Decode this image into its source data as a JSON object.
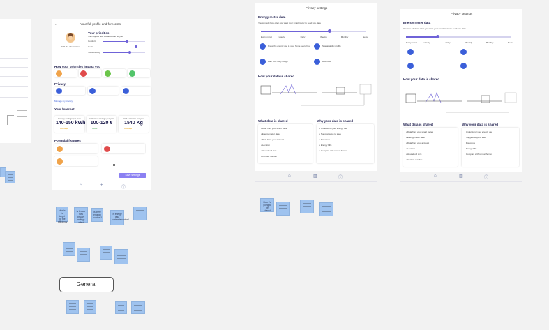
{
  "frame1": {
    "rows": [
      "",
      "",
      "",
      "",
      "",
      ""
    ],
    "legend": [
      "",
      "",
      ""
    ]
  },
  "frame2": {
    "back": "←",
    "title": "Your full profile and forecasts",
    "priorities_title": "Your priorities",
    "priorities_sub": "This adjusts how we tailor data to you",
    "priorities": [
      {
        "label": "Comfort",
        "level": 0.55
      },
      {
        "label": "Costs",
        "level": 0.78
      },
      {
        "label": "Sustainability",
        "level": 0.62
      }
    ],
    "avatar_caption": "Edit the information",
    "impact_title": "How your priorities impact you",
    "impact_colors": [
      "#f0a34a",
      "#e04b4b",
      "#6bc54a",
      "#52c46a"
    ],
    "privacy_title": "Privacy",
    "privacy_link": "Manage my privacy",
    "forecast_title": "Your forecast",
    "forecasts": [
      {
        "label": "Energy savings per year",
        "value": "140-150 kWh",
        "tag": "Average",
        "tag_kind": "warn"
      },
      {
        "label": "Estimated savings per year",
        "value": "100-120 €",
        "tag": "Good",
        "tag_kind": "ok"
      },
      {
        "label": "CO2 emission per year",
        "value": "1540 Kg",
        "tag": "Average",
        "tag_kind": "warn"
      }
    ],
    "features_title": "Potential features",
    "cta": "Save settings",
    "notes": [
      "How is the target for the efficiency?",
      "Is it clear how privacy settings affect",
      "Is there enough context?",
      "Is energy data understandable?",
      "",
      "",
      "",
      "",
      "",
      "",
      "",
      ""
    ],
    "general_label": "General"
  },
  "frame3": {
    "title": "Privacy settings",
    "meter_title": "Energy meter data",
    "meter_sub": "You can edit how often you want your smart meter to send you data",
    "slider_labels": [
      "Every minute",
      "Hourly",
      "Daily",
      "Weekly",
      "Monthly",
      "Never"
    ],
    "slider_level": 0.65,
    "bullets": [
      "Know the energy use in your home every hour",
      "Sustainability profile",
      "Plan your daily usage",
      "Bills track"
    ],
    "shared_title": "How your data is shared",
    "what_title": "What data is shared",
    "why_title": "Why your data is shared",
    "what_items": [
      "Data from your smart meter",
      "Energy meter data",
      "Data from your account",
      "Location",
      "Household size",
      "Contact number"
    ],
    "why_items": [
      "Understand your energy use",
      "Suggest ways to save",
      "Forecasts",
      "Energy bills",
      "Compare with similar homes"
    ],
    "notes": [
      "How it's going to be shared",
      "",
      "",
      ""
    ]
  },
  "frame4": {
    "title": "Privacy settings",
    "meter_title": "Energy meter data",
    "meter_sub": "You can edit how often you want your smart meter to send you data",
    "slider_labels": [
      "Every minute",
      "Hourly",
      "Daily",
      "Weekly",
      "Monthly",
      "Never"
    ],
    "slider_level": 0.3,
    "shared_title": "How your data is shared",
    "what_title": "What data is shared",
    "why_title": "Why your data is shared",
    "what_items": [
      "Data from your smart meter",
      "Energy meter data",
      "Data from your account",
      "Location",
      "Household size",
      "Contact number"
    ],
    "why_items": [
      "Understand your energy use",
      "Suggest ways to save",
      "Forecasts",
      "Energy bills",
      "Compare with similar homes"
    ]
  },
  "colors": {
    "accent": "#6f63d8",
    "badge_blue": "#3b5fd9",
    "note": "#9fc3ef"
  }
}
